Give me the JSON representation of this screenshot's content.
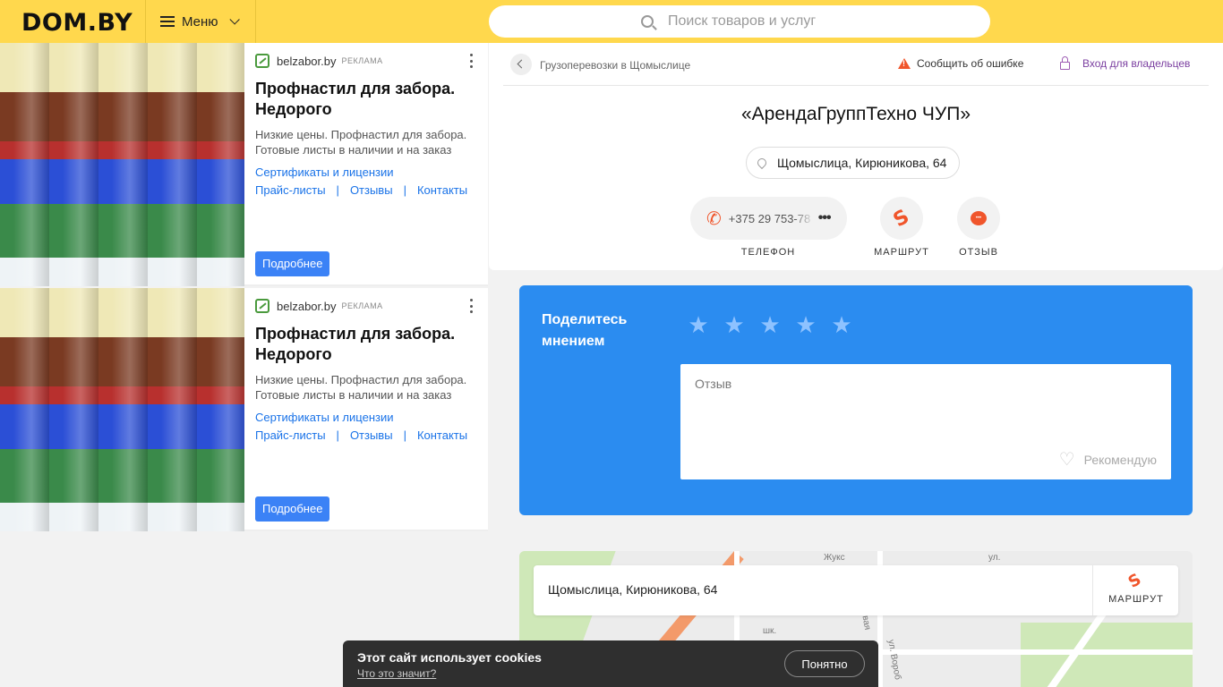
{
  "header": {
    "logo": "DOM.BY",
    "menu_label": "Меню",
    "search_placeholder": "Поиск товаров и услуг"
  },
  "ads": [
    {
      "domain": "belzabor.by",
      "tag": "РЕКЛАМА",
      "title": "Профнастил для забора. Недорого",
      "description": "Низкие цены. Профнастил для забора. Готовые листы в наличии и на заказ",
      "link_certificates": "Сертификаты и лицензии",
      "link_prices": "Прайс-листы",
      "link_reviews": "Отзывы",
      "link_contacts": "Контакты",
      "separator": "|",
      "button": "Подробнее"
    },
    {
      "domain": "belzabor.by",
      "tag": "РЕКЛАМА",
      "title": "Профнастил для забора. Недорого",
      "description": "Низкие цены. Профнастил для забора. Готовые листы в наличии и на заказ",
      "link_certificates": "Сертификаты и лицензии",
      "link_prices": "Прайс-листы",
      "link_reviews": "Отзывы",
      "link_contacts": "Контакты",
      "separator": "|",
      "button": "Подробнее"
    }
  ],
  "card": {
    "breadcrumb": "Грузоперевозки в Щомыслице",
    "report_error": "Сообщить об ошибке",
    "owner_login": "Вход для владельцев",
    "company_name": "«АрендаГруппТехно ЧУП»",
    "address": "Щомыслица, Кирюникова, 64",
    "phone": "+375 29 753-78",
    "phone_more": "•••",
    "action_phone": "ТЕЛЕФОН",
    "action_route": "МАРШРУТ",
    "action_review": "ОТЗЫВ"
  },
  "review": {
    "title": "Поделитесь мнением",
    "placeholder": "Отзыв",
    "recommend": "Рекомендую",
    "stars": [
      "★",
      "★",
      "★",
      "★",
      "★"
    ]
  },
  "map": {
    "address": "Щомыслица, Кирюникова, 64",
    "route_label": "МАРШРУТ",
    "labels": [
      "Жукс",
      "ул.",
      "шк.",
      "овая",
      "ул. Вороб"
    ]
  },
  "cookie": {
    "title": "Этот сайт использует cookies",
    "link": "Что это значит?",
    "button": "Понятно"
  },
  "icons": {
    "phone": "✆",
    "route": "S",
    "heart": "♡"
  },
  "colors": {
    "header_bg": "#ffd84d",
    "accent_orange": "#f0552b",
    "review_bg": "#2b8cf0",
    "link_blue": "#1a73e8",
    "owner_purple": "#7b3fa0",
    "ad_button": "#3b82f6",
    "cookie_bg": "#2f2f2f"
  }
}
